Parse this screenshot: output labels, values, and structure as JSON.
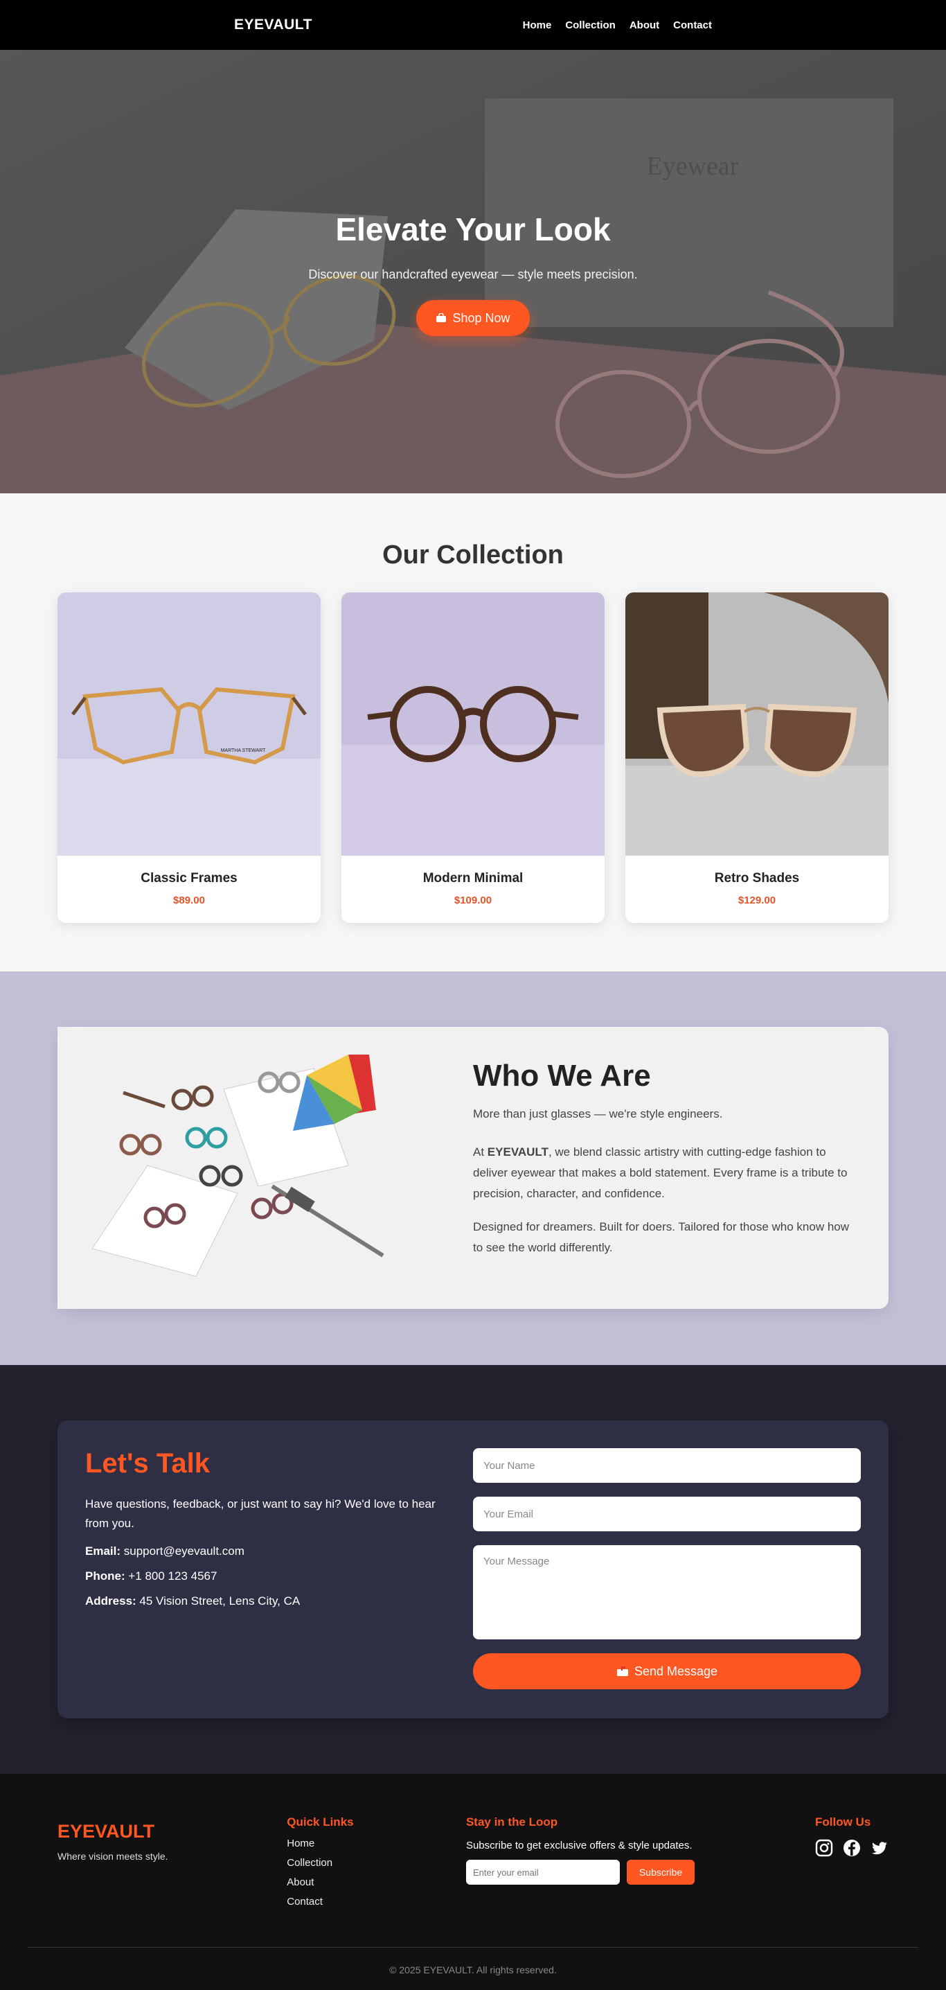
{
  "nav": {
    "brand": "EYEVAULT",
    "links": [
      "Home",
      "Collection",
      "About",
      "Contact"
    ]
  },
  "hero": {
    "title": "Elevate Your Look",
    "subtitle": "Discover our handcrafted eyewear — style meets precision.",
    "button_label": "Shop Now",
    "button_icon": "shopping-bag-icon"
  },
  "collection": {
    "title": "Our Collection",
    "items": [
      {
        "name": "Classic Frames",
        "price": "$89.00"
      },
      {
        "name": "Modern Minimal",
        "price": "$109.00"
      },
      {
        "name": "Retro Shades",
        "price": "$129.00"
      }
    ]
  },
  "about": {
    "title": "Who We Are",
    "lead": "More than just glasses — we're style engineers.",
    "p1_prefix": "At ",
    "p1_brand": "EYEVAULT",
    "p1_rest": ", we blend classic artistry with cutting-edge fashion to deliver eyewear that makes a bold statement. Every frame is a tribute to precision, character, and confidence.",
    "p2": "Designed for dreamers. Built for doers. Tailored for those who know how to see the world differently."
  },
  "contact": {
    "title": "Let's Talk",
    "intro": "Have questions, feedback, or just want to say hi? We'd love to hear from you.",
    "email_label": "Email:",
    "email_value": "support@eyevault.com",
    "phone_label": "Phone:",
    "phone_value": "+1 800 123 4567",
    "address_label": "Address:",
    "address_value": "45 Vision Street, Lens City, CA",
    "name_placeholder": "Your Name",
    "email_placeholder": "Your Email",
    "message_placeholder": "Your Message",
    "send_label": "Send Message"
  },
  "footer": {
    "brand": "EYEVAULT",
    "tagline": "Where vision meets style.",
    "quick_links_title": "Quick Links",
    "quick_links": [
      "Home",
      "Collection",
      "About",
      "Contact"
    ],
    "newsletter_title": "Stay in the Loop",
    "newsletter_text": "Subscribe to get exclusive offers & style updates.",
    "newsletter_placeholder": "Enter your email",
    "subscribe_label": "Subscribe",
    "follow_title": "Follow Us",
    "social_icons": [
      "instagram-icon",
      "facebook-icon",
      "twitter-icon"
    ],
    "copyright": "© 2025 EYEVAULT. All rights reserved."
  },
  "colors": {
    "accent": "#ff5722",
    "nav_bg": "#000000",
    "about_bg": "#c3bfd7",
    "contact_bg": "#23222f",
    "contact_card": "#2e2e44",
    "footer_bg": "#111111"
  }
}
